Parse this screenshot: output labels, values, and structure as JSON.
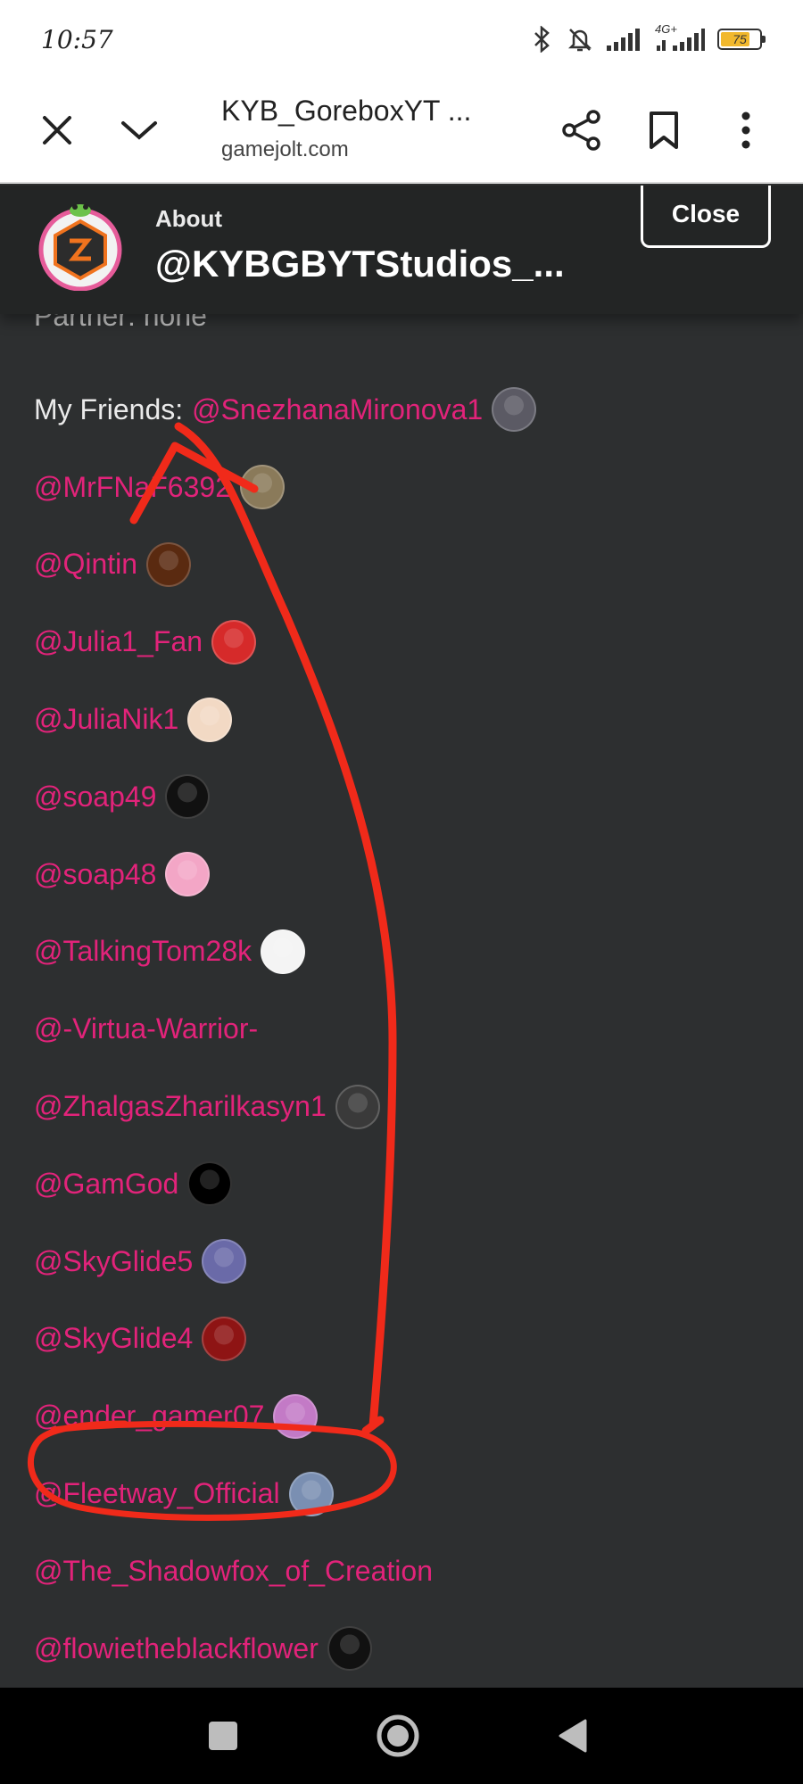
{
  "status_bar": {
    "time": "10:57",
    "network": "4G+",
    "battery_level": "75",
    "battery_fraction": 0.75,
    "icons": [
      "bluetooth-icon",
      "mute-bell-icon",
      "signal-icon",
      "signal-4g-icon",
      "battery-icon"
    ]
  },
  "browser": {
    "page_title": "KYB_GoreboxYT ...",
    "domain": "gamejolt.com"
  },
  "about_header": {
    "label": "About",
    "username": "@KYBGBYTStudios_...",
    "close_label": "Close"
  },
  "content": {
    "partner_line": "Partner: none",
    "friends_prefix": "My Friends:",
    "friends": [
      {
        "handle": "@SnezhanaMironova1",
        "avatar": "#5b5a64"
      },
      {
        "handle": "@MrFNaF6392",
        "avatar": "#8a7a5a"
      },
      {
        "handle": "@Qintin",
        "avatar": "#5a2a10"
      },
      {
        "handle": "@Julia1_Fan",
        "avatar": "#d62a2a"
      },
      {
        "handle": "@JuliaNik1",
        "avatar": "#f2d9c4"
      },
      {
        "handle": "@soap49",
        "avatar": "#111111"
      },
      {
        "handle": "@soap48",
        "avatar": "#f3a6c6"
      },
      {
        "handle": "@TalkingTom28k",
        "avatar": "#f4f4f4"
      },
      {
        "handle": "@-Virtua-Warrior-",
        "avatar": ""
      },
      {
        "handle": "@ZhalgasZharilkasyn1",
        "avatar": "#3a3a3a"
      },
      {
        "handle": "@GamGod",
        "avatar": "#000000"
      },
      {
        "handle": "@SkyGlide5",
        "avatar": "#6a6aa8"
      },
      {
        "handle": "@SkyGlide4",
        "avatar": "#8e1414"
      },
      {
        "handle": "@ender_gamer07",
        "avatar": "#c37ac6"
      },
      {
        "handle": "@Fleetway_Official",
        "avatar": "#7a8fb2"
      },
      {
        "handle": "@The_Shadowfox_of_Creation",
        "avatar": ""
      },
      {
        "handle": "@flowietheblackflower",
        "avatar": "#111111"
      }
    ]
  },
  "annotation": {
    "color": "#f02a1a",
    "description_icons": [
      "annotation-arrow-icon",
      "annotation-circle-icon"
    ]
  },
  "colors": {
    "background": "#2d2f30",
    "header": "#232525",
    "mention": "#e2237a"
  }
}
